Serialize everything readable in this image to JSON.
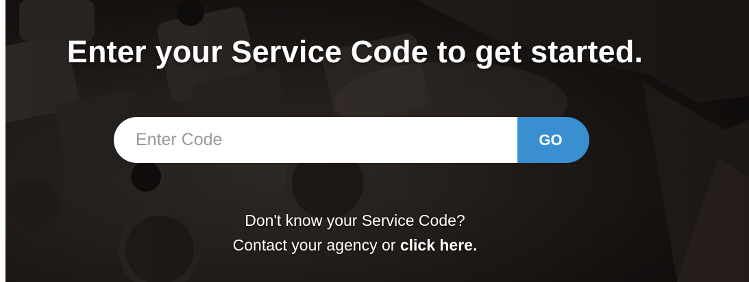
{
  "headline": "Enter your Service Code to get started.",
  "search": {
    "placeholder": "Enter Code",
    "value": "",
    "button_label": "GO"
  },
  "help": {
    "question": "Don't know your Service Code?",
    "contact_prefix": "Contact your agency or ",
    "link_label": "click here."
  },
  "colors": {
    "accent": "#3a8fd0",
    "background": "#26201d",
    "text": "#ffffff",
    "placeholder": "#999999"
  }
}
